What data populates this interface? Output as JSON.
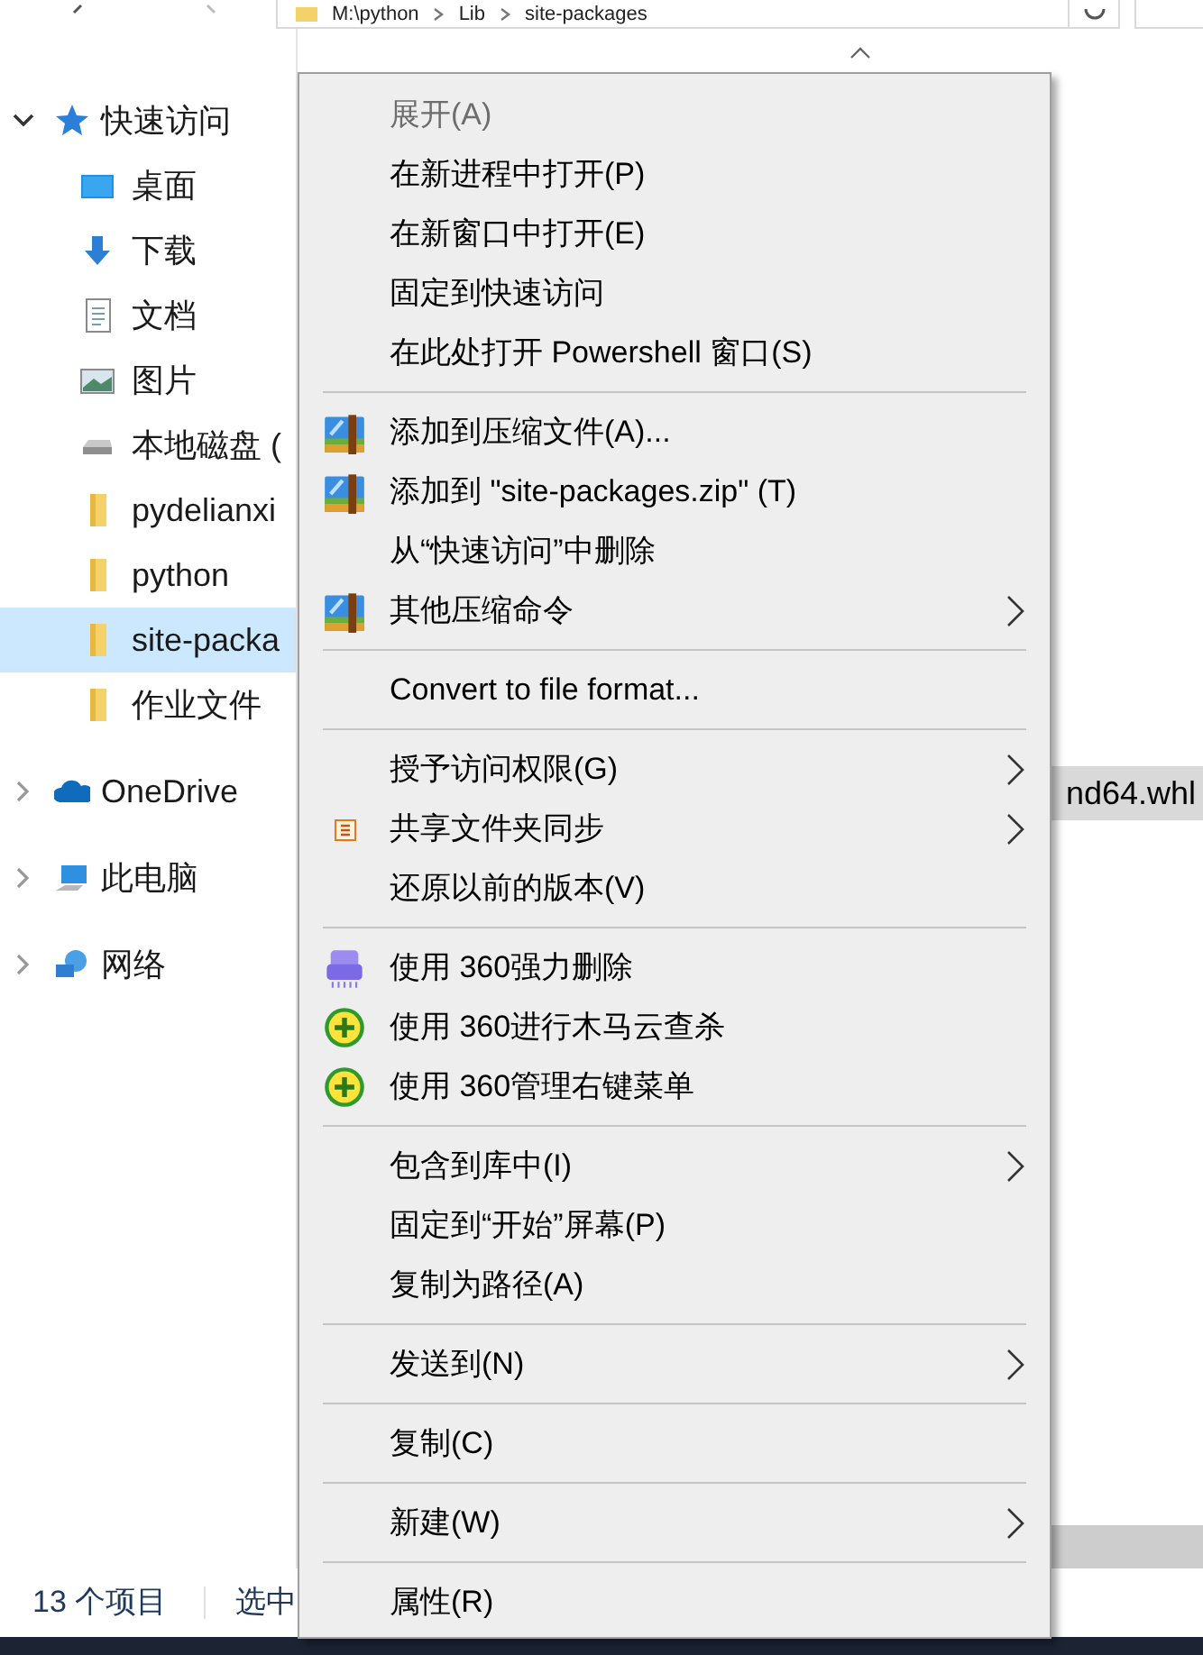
{
  "address_bar": {
    "segments": [
      "M:\\python",
      "Lib",
      "site-packages"
    ]
  },
  "navigation": [
    {
      "label": "快速访问",
      "kind": "star",
      "expanded": true,
      "selected": false,
      "children": [
        {
          "label": "桌面",
          "kind": "desktop",
          "selected": false
        },
        {
          "label": "下载",
          "kind": "download",
          "selected": false
        },
        {
          "label": "文档",
          "kind": "document",
          "selected": false
        },
        {
          "label": "图片",
          "kind": "pictures",
          "selected": false
        },
        {
          "label": "本地磁盘 (",
          "kind": "drive",
          "selected": false
        },
        {
          "label": "pydelianxi",
          "kind": "folder",
          "selected": false
        },
        {
          "label": "python",
          "kind": "folder",
          "selected": false
        },
        {
          "label": "site-packa",
          "kind": "folder",
          "selected": true
        },
        {
          "label": "作业文件",
          "kind": "folder",
          "selected": false
        }
      ]
    },
    {
      "label": "OneDrive",
      "kind": "cloud",
      "expanded": false,
      "selected": false
    },
    {
      "label": "此电脑",
      "kind": "computer",
      "expanded": false,
      "selected": false
    },
    {
      "label": "网络",
      "kind": "network",
      "expanded": false,
      "selected": false
    }
  ],
  "file_list": {
    "rows": [
      {
        "name": "nd64.whl",
        "selected": true
      }
    ]
  },
  "status_bar": {
    "item_count": "13 个项目",
    "selection": "选中"
  },
  "context_menu": {
    "groups": [
      [
        {
          "label": "展开(A)",
          "disabled": true,
          "submenu": false
        },
        {
          "label": "在新进程中打开(P)",
          "disabled": false,
          "submenu": false
        },
        {
          "label": "在新窗口中打开(E)",
          "disabled": false,
          "submenu": false
        },
        {
          "label": "固定到快速访问",
          "disabled": false,
          "submenu": false
        },
        {
          "label": "在此处打开 Powershell 窗口(S)",
          "disabled": false,
          "submenu": false
        }
      ],
      [
        {
          "label": "添加到压缩文件(A)...",
          "kind": "archive",
          "disabled": false,
          "submenu": false
        },
        {
          "label": "添加到 \"site-packages.zip\" (T)",
          "kind": "archive",
          "disabled": false,
          "submenu": false
        },
        {
          "label": "从“快速访问”中删除",
          "disabled": false,
          "submenu": false
        },
        {
          "label": "其他压缩命令",
          "kind": "archive",
          "disabled": false,
          "submenu": true
        }
      ],
      [
        {
          "label": "Convert to file format...",
          "disabled": false,
          "submenu": false
        }
      ],
      [
        {
          "label": "授予访问权限(G)",
          "disabled": false,
          "submenu": true
        },
        {
          "label": "共享文件夹同步",
          "kind": "sync",
          "disabled": false,
          "submenu": true
        },
        {
          "label": "还原以前的版本(V)",
          "disabled": false,
          "submenu": false
        }
      ],
      [
        {
          "label": "使用 360强力删除",
          "kind": "shredder",
          "disabled": false,
          "submenu": false
        },
        {
          "label": "使用 360进行木马云查杀",
          "kind": "plus-circle",
          "disabled": false,
          "submenu": false
        },
        {
          "label": "使用 360管理右键菜单",
          "kind": "plus-circle",
          "disabled": false,
          "submenu": false
        }
      ],
      [
        {
          "label": "包含到库中(I)",
          "disabled": false,
          "submenu": true
        },
        {
          "label": "固定到“开始”屏幕(P)",
          "disabled": false,
          "submenu": false
        },
        {
          "label": "复制为路径(A)",
          "disabled": false,
          "submenu": false
        }
      ],
      [
        {
          "label": "发送到(N)",
          "disabled": false,
          "submenu": true
        }
      ],
      [
        {
          "label": "复制(C)",
          "disabled": false,
          "submenu": false
        }
      ],
      [
        {
          "label": "新建(W)",
          "disabled": false,
          "submenu": true
        }
      ],
      [
        {
          "label": "属性(R)",
          "disabled": false,
          "submenu": false
        }
      ]
    ]
  }
}
